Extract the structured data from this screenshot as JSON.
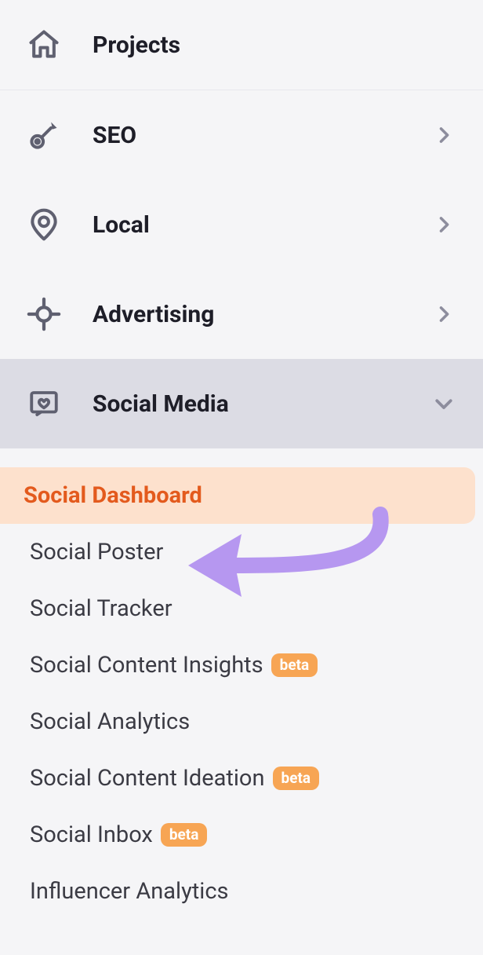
{
  "nav": {
    "projects": {
      "label": "Projects"
    },
    "seo": {
      "label": "SEO"
    },
    "local": {
      "label": "Local"
    },
    "advertising": {
      "label": "Advertising"
    },
    "social": {
      "label": "Social Media"
    }
  },
  "submenu": {
    "dashboard": {
      "label": "Social Dashboard"
    },
    "poster": {
      "label": "Social Poster"
    },
    "tracker": {
      "label": "Social Tracker"
    },
    "content_insights": {
      "label": "Social Content Insights",
      "badge": "beta"
    },
    "analytics": {
      "label": "Social Analytics"
    },
    "content_ideation": {
      "label": "Social Content Ideation",
      "badge": "beta"
    },
    "inbox": {
      "label": "Social Inbox",
      "badge": "beta"
    },
    "influencer": {
      "label": "Influencer Analytics"
    }
  },
  "annotation": {
    "arrow_color": "#b697f0"
  }
}
